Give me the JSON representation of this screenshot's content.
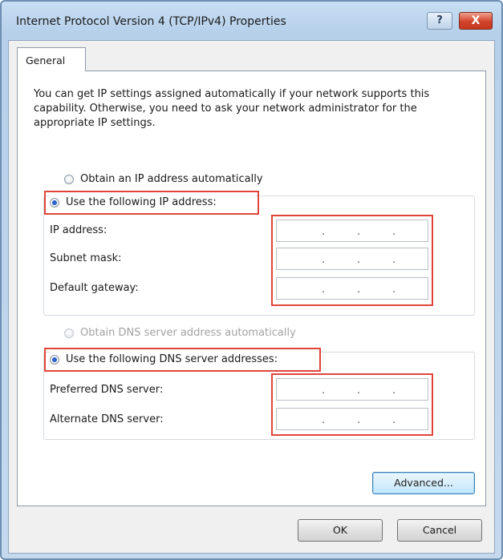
{
  "window": {
    "title": "Internet Protocol Version 4 (TCP/IPv4) Properties",
    "help_label": "?",
    "close_label": "X"
  },
  "tabs": [
    {
      "label": "General",
      "selected": true
    }
  ],
  "intro_text": "You can get IP settings assigned automatically if your network supports this capability. Otherwise, you need to ask your network administrator for the appropriate IP settings.",
  "ip_section": {
    "auto_option": {
      "label": "Obtain an IP address automatically",
      "checked": false
    },
    "manual_option": {
      "label": "Use the following IP address:",
      "checked": true
    },
    "fields": [
      {
        "label": "IP address:",
        "value": ". . ."
      },
      {
        "label": "Subnet mask:",
        "value": ". . ."
      },
      {
        "label": "Default gateway:",
        "value": ". . ."
      }
    ]
  },
  "dns_section": {
    "auto_option": {
      "label": "Obtain DNS server address automatically",
      "checked": false,
      "disabled": true
    },
    "manual_option": {
      "label": "Use the following DNS server addresses:",
      "checked": true
    },
    "fields": [
      {
        "label": "Preferred DNS server:",
        "value": ". . ."
      },
      {
        "label": "Alternate DNS server:",
        "value": ". . ."
      }
    ]
  },
  "buttons": {
    "advanced": "Advanced...",
    "ok": "OK",
    "cancel": "Cancel"
  },
  "colors": {
    "highlight": "#e0453a",
    "radio_selected": "#2a62c9",
    "title_bar": "#b6d0ea"
  }
}
